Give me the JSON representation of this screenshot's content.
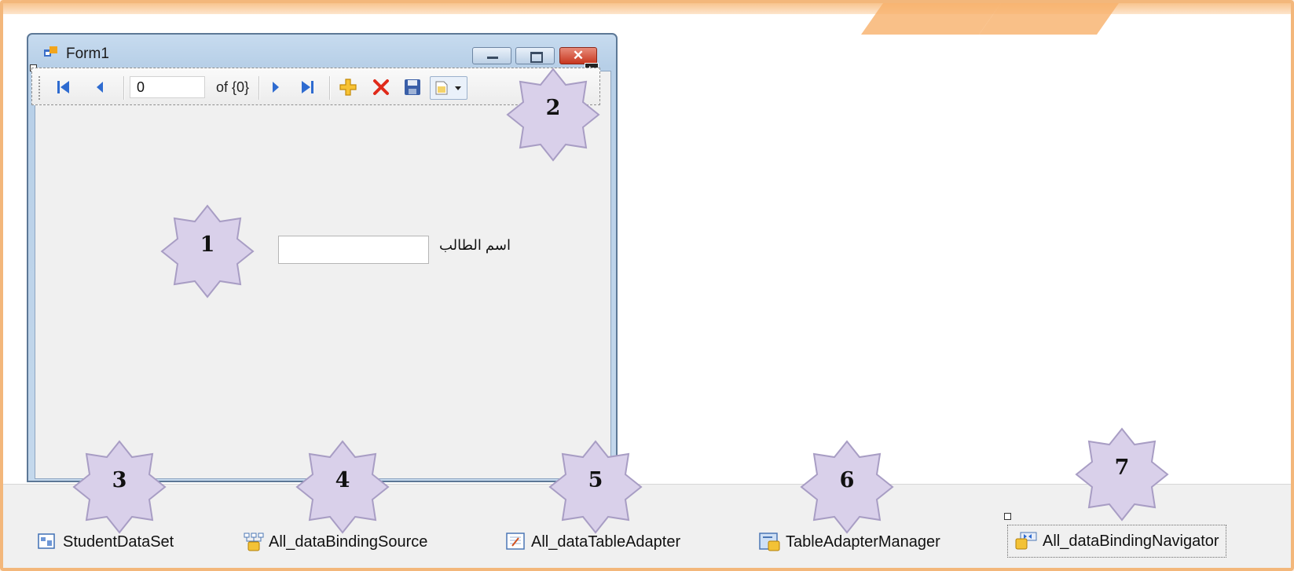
{
  "form": {
    "title": "Form1",
    "close_glyph": "✕"
  },
  "navigator": {
    "position_value": "0",
    "count_text": "of {0}",
    "buttons": [
      "move-first-icon",
      "move-previous-icon",
      "move-next-icon",
      "move-last-icon",
      "add-new-icon",
      "delete-icon",
      "save-icon",
      "document-dropdown-icon"
    ]
  },
  "field": {
    "label": "اسم الطالب",
    "value": ""
  },
  "tray": {
    "components": [
      {
        "label": "StudentDataSet",
        "icon": "dataset-icon"
      },
      {
        "label": "All_dataBindingSource",
        "icon": "binding-source-icon"
      },
      {
        "label": "All_dataTableAdapter",
        "icon": "table-adapter-icon"
      },
      {
        "label": "TableAdapterManager",
        "icon": "adapter-manager-icon"
      },
      {
        "label": "All_dataBindingNavigator",
        "icon": "binding-navigator-icon"
      }
    ]
  },
  "callouts": [
    "1",
    "2",
    "3",
    "4",
    "5",
    "6",
    "7"
  ],
  "colors": {
    "border_orange": "#f3b77b",
    "star_fill": "#d9d0ea",
    "window_blue": "#b7cfe7"
  }
}
